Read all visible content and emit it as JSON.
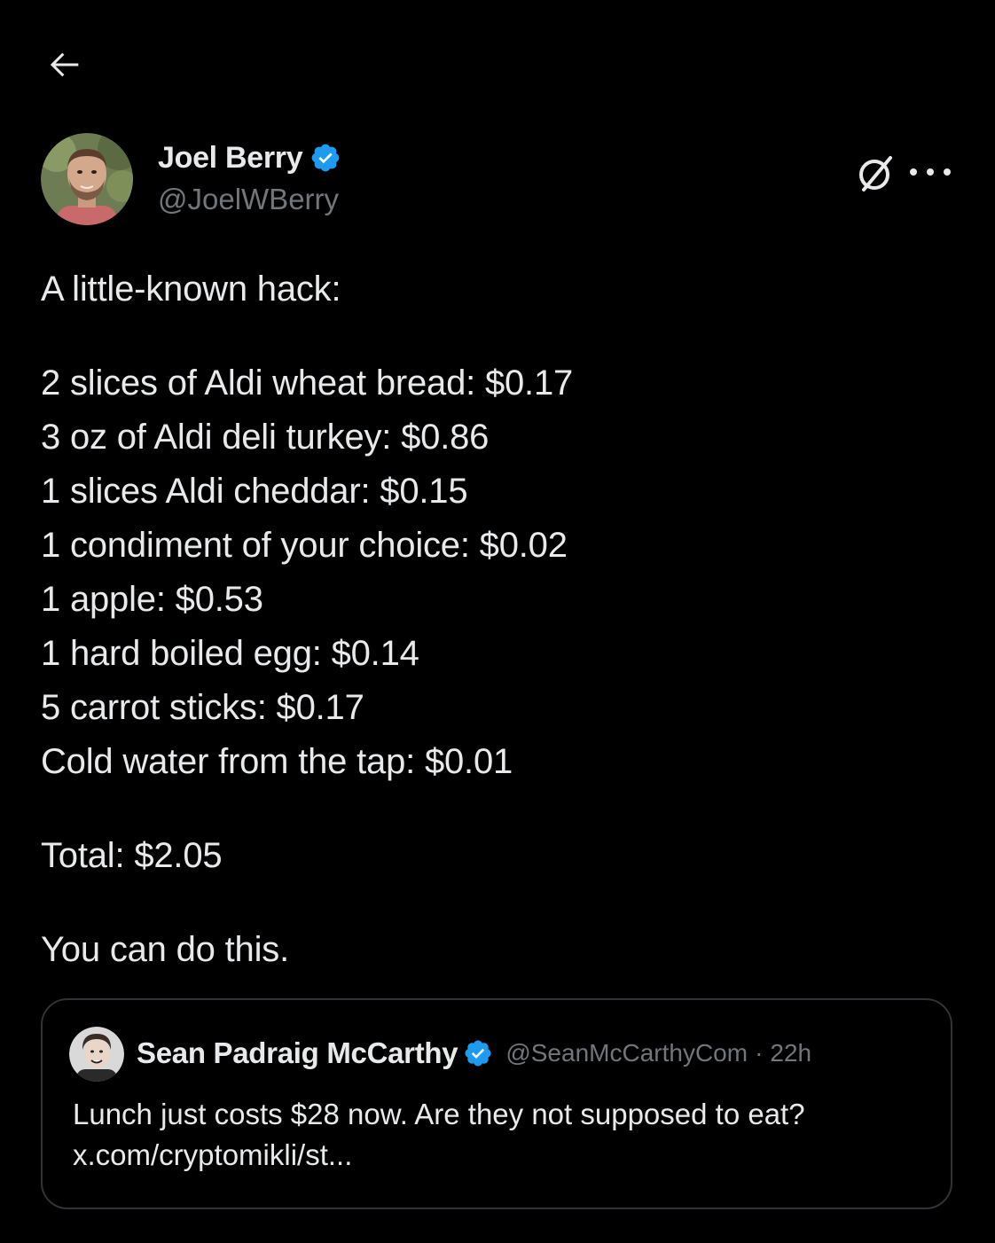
{
  "nav": {
    "back_icon": "arrow-left-icon"
  },
  "author": {
    "display_name": "Joel Berry",
    "handle": "@JoelWBerry",
    "verified": true,
    "verified_color": "#1d9bf0",
    "avatar_icon": "user-avatar"
  },
  "actions": {
    "grok_icon": "grok-icon",
    "more_icon": "more-options-icon"
  },
  "tweet": {
    "intro": "A little-known hack:",
    "items": [
      "2 slices of Aldi wheat bread: $0.17",
      "3 oz of Aldi deli turkey: $0.86",
      "1 slices Aldi cheddar: $0.15",
      "1 condiment of your choice: $0.02",
      "1 apple: $0.53",
      "1 hard boiled egg: $0.14",
      "5 carrot sticks: $0.17",
      "Cold water from the tap: $0.01"
    ],
    "total": "Total: $2.05",
    "closing": "You can do this."
  },
  "quoted": {
    "display_name": "Sean Padraig McCarthy",
    "handle": "@SeanMcCarthyCom",
    "separator": "·",
    "time": "22h",
    "verified": true,
    "text_line1": "Lunch just costs $28 now. Are they not supposed to eat?",
    "text_line2": "x.com/cryptomikli/st..."
  },
  "colors": {
    "background": "#000000",
    "text_primary": "#e7e9ea",
    "text_secondary": "#71767b",
    "border": "#2f3336",
    "accent": "#1d9bf0"
  }
}
